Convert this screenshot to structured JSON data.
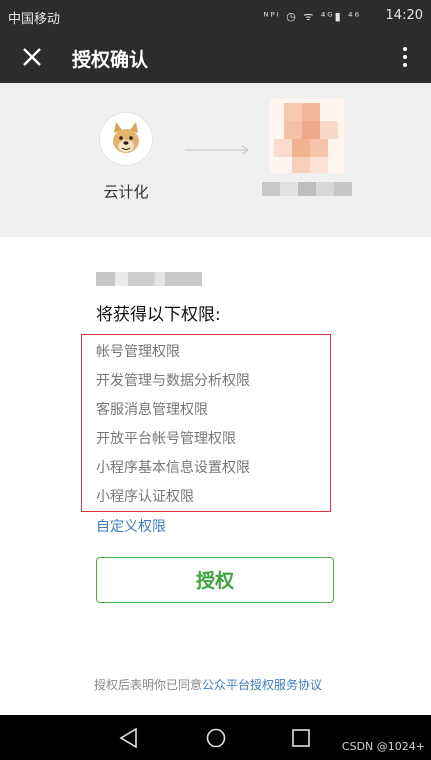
{
  "status_bar": {
    "carrier": "中国移动",
    "icons": "ᴺᴾᴵ ◷ ᯤ ⁴ᴳ▮ ⁴⁶",
    "time": "14:20"
  },
  "app_bar": {
    "title": "授权确认",
    "close_icon": "close-icon",
    "more_icon": "more-vertical-icon"
  },
  "header": {
    "app_name": "云计化",
    "app_avatar_icon": "doge-avatar-icon",
    "connector_icon": "arrow-right-icon"
  },
  "permissions": {
    "heading": "将获得以下权限:",
    "items": [
      "帐号管理权限",
      "开发管理与数据分析权限",
      "客服消息管理权限",
      "开放平台帐号管理权限",
      "小程序基本信息设置权限",
      "小程序认证权限"
    ],
    "custom_link": "自定义权限",
    "highlight_color": "#d9363e"
  },
  "authorize_button": {
    "label": "授权",
    "color": "#45b345"
  },
  "agreement": {
    "prefix": "授权后表明你已同意",
    "link": "公众平台授权服务协议"
  },
  "nav_bar": {
    "back_icon": "back-triangle-icon",
    "home_icon": "home-circle-icon",
    "recents_icon": "recents-square-icon"
  },
  "watermark": "CSDN @1024+"
}
